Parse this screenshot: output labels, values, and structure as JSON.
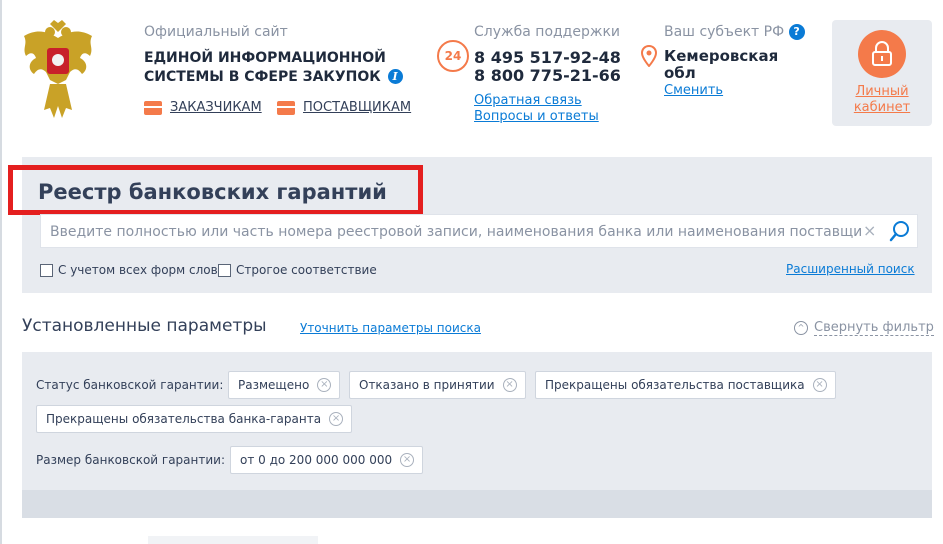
{
  "header": {
    "site_subtitle": "Официальный сайт",
    "site_title_line1": "ЕДИНОЙ ИНФОРМАЦИОННОЙ",
    "site_title_line2": "СИСТЕМЫ В СФЕРЕ ЗАКУПОК",
    "info_icon": "i",
    "nav": {
      "customers": "ЗАКАЗЧИКАМ",
      "suppliers": "ПОСТАВЩИКАМ"
    }
  },
  "support": {
    "label": "Служба поддержки",
    "badge": "24",
    "phone1": "8 495 517-92-48",
    "phone2": "8 800 775-21-66",
    "feedback": "Обратная связь",
    "faq": "Вопросы и ответы"
  },
  "region": {
    "label": "Ваш субъект РФ",
    "help_icon": "?",
    "name": "Кемеровская обл",
    "change": "Сменить"
  },
  "cabinet": {
    "label": "Личный кабинет"
  },
  "registry": {
    "title": "Реестр банковских гарантий",
    "search_placeholder": "Введите полностью или часть номера реестровой записи, наименования банка или наименования поставщика",
    "clear_icon": "×",
    "opt_all_forms": "С учетом всех форм слов",
    "opt_strict": "Строгое соответствие",
    "advanced_search": "Расширенный поиск"
  },
  "params": {
    "title": "Установленные параметры",
    "refine": "Уточнить параметры поиска",
    "collapse": "Свернуть фильтр",
    "collapse_icon": "^",
    "status_label": "Статус банковской гарантии:",
    "status_chips": [
      "Размещено",
      "Отказано в принятии",
      "Прекращены обязательства поставщика",
      "Прекращены обязательства банка-гаранта"
    ],
    "size_label": "Размер банковской гарантии:",
    "size_chip": "от 0 до 200 000 000 000",
    "chip_remove_icon": "×"
  },
  "colors": {
    "accent": "#f47a4a",
    "link": "#0a7bd6",
    "panel": "#e8ebf0",
    "highlight": "#e41f1f"
  }
}
